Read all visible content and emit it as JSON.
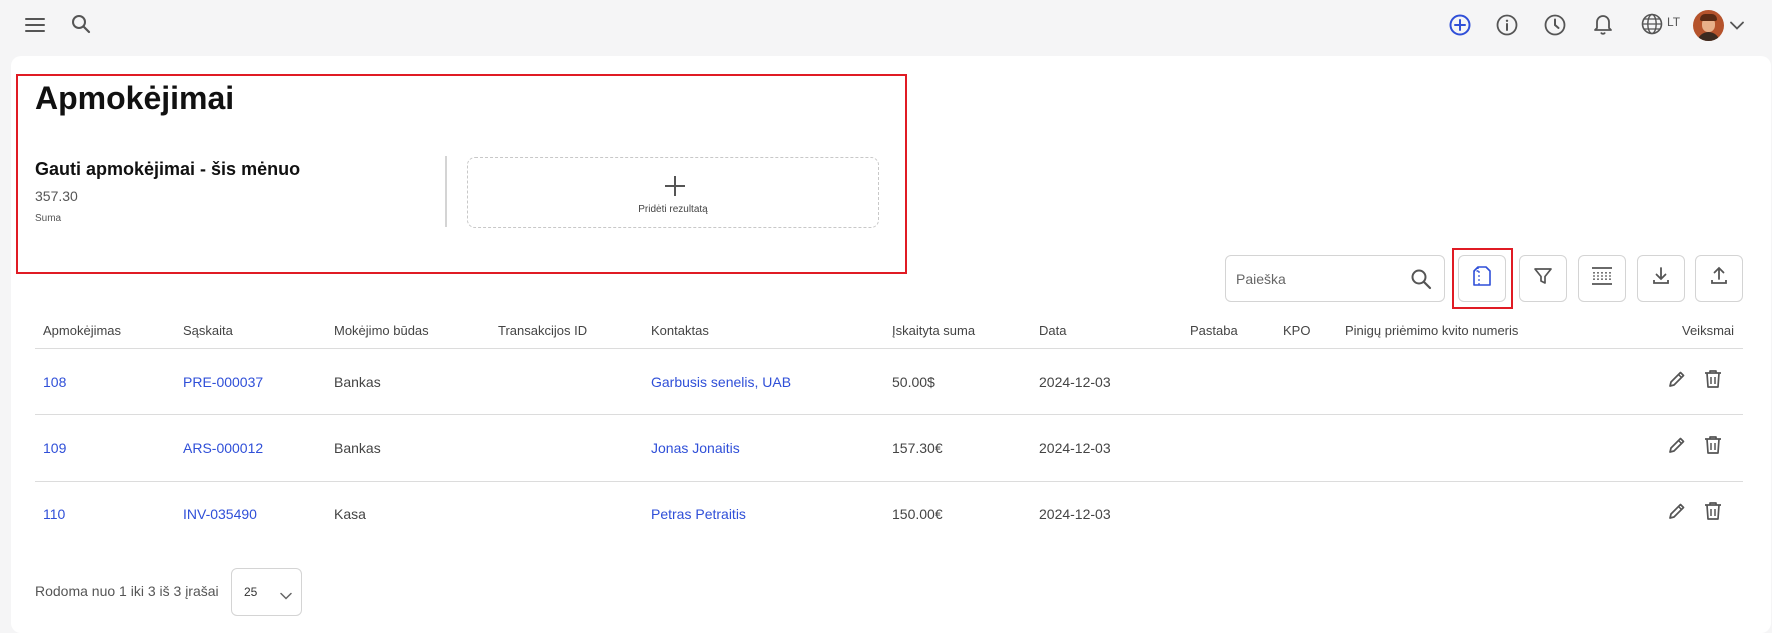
{
  "topbar": {
    "lang": "LT",
    "icons": [
      "menu-icon",
      "search-icon",
      "add-circle-icon",
      "info-icon",
      "clock-icon",
      "bell-icon",
      "globe-icon",
      "chevron-down-icon"
    ],
    "accent": "#2f4fd8"
  },
  "page": {
    "title": "Apmokėjimai"
  },
  "stat": {
    "title": "Gauti apmokėjimai - šis mėnuo",
    "value": "357.30",
    "sub": "Suma"
  },
  "add_result": {
    "label": "Pridėti rezultatą"
  },
  "search": {
    "placeholder": "Paieška"
  },
  "toolbar": {
    "icons": [
      "document-icon",
      "filter-icon",
      "columns-icon",
      "download-icon",
      "upload-icon"
    ]
  },
  "table": {
    "columns": [
      "Apmokėjimas",
      "Sąskaita",
      "Mokėjimo būdas",
      "Transakcijos ID",
      "Kontaktas",
      "Įskaityta suma",
      "Data",
      "Pastaba",
      "KPO",
      "Pinigų priėmimo kvito numeris",
      "Veiksmai"
    ],
    "rows": [
      {
        "payment": "108",
        "invoice": "PRE-000037",
        "method": "Bankas",
        "transaction": "",
        "contact": "Garbusis senelis, UAB",
        "amount": "50.00$",
        "date": "2024-12-03",
        "note": "",
        "kpo": "",
        "receipt": ""
      },
      {
        "payment": "109",
        "invoice": "ARS-000012",
        "method": "Bankas",
        "transaction": "",
        "contact": "Jonas Jonaitis",
        "amount": "157.30€",
        "date": "2024-12-03",
        "note": "",
        "kpo": "",
        "receipt": ""
      },
      {
        "payment": "110",
        "invoice": "INV-035490",
        "method": "Kasa",
        "transaction": "",
        "contact": "Petras Petraitis",
        "amount": "150.00€",
        "date": "2024-12-03",
        "note": "",
        "kpo": "",
        "receipt": ""
      }
    ]
  },
  "footer": {
    "text": "Rodoma nuo 1 iki 3 iš 3 įrašai",
    "page_size": "25"
  },
  "colors": {
    "highlight": "#e01b24",
    "link": "#2f4fd8"
  }
}
